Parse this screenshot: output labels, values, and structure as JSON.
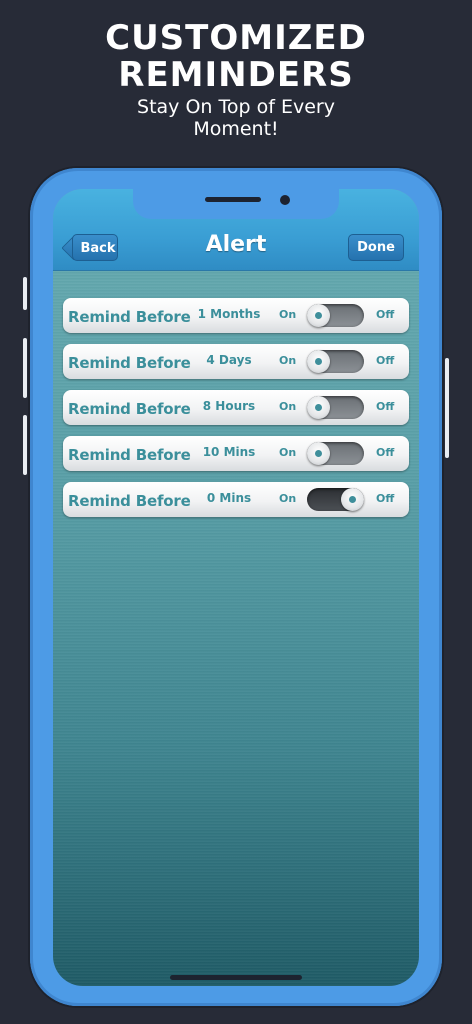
{
  "promo": {
    "headline_line1": "CUSTOMIZED",
    "headline_line2": "REMINDERS",
    "sub_line1": "Stay On Top of Every",
    "sub_line2": "Moment!"
  },
  "navbar": {
    "title": "Alert",
    "back_label": "Back",
    "done_label": "Done"
  },
  "colors": {
    "accent_text": "#3b8f9b",
    "phone_frame": "#4d9be6",
    "background": "#272b37"
  },
  "reminders": [
    {
      "label": "Remind Before",
      "value": "1 Months",
      "on_label": "On",
      "off_label": "Off",
      "state": "off"
    },
    {
      "label": "Remind Before",
      "value": "4 Days",
      "on_label": "On",
      "off_label": "Off",
      "state": "off"
    },
    {
      "label": "Remind Before",
      "value": "8 Hours",
      "on_label": "On",
      "off_label": "Off",
      "state": "off"
    },
    {
      "label": "Remind Before",
      "value": "10 Mins",
      "on_label": "On",
      "off_label": "Off",
      "state": "off"
    },
    {
      "label": "Remind Before",
      "value": "0 Mins",
      "on_label": "On",
      "off_label": "Off",
      "state": "on"
    }
  ]
}
